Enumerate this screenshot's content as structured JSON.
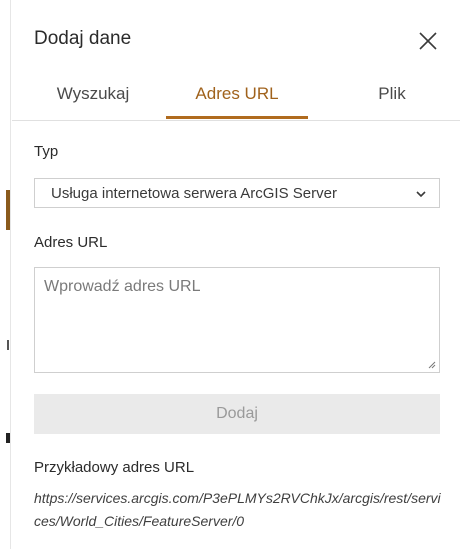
{
  "dialog": {
    "title": "Dodaj dane"
  },
  "tabs": [
    {
      "label": "Wyszukaj",
      "active": false
    },
    {
      "label": "Adres URL",
      "active": true
    },
    {
      "label": "Plik",
      "active": false
    }
  ],
  "form": {
    "type_label": "Typ",
    "type_value": "Usługa internetowa serwera ArcGIS Server",
    "url_label": "Adres URL",
    "url_placeholder": "Wprowadź adres URL",
    "url_value": "",
    "add_label": "Dodaj",
    "add_enabled": false
  },
  "example": {
    "title": "Przykładowy adres URL",
    "url": "https://services.arcgis.com/P3ePLMYs2RVChkJx/arcgis/rest/services/World_Cities/FeatureServer/0"
  },
  "colors": {
    "accent": "#b06b1e",
    "disabled_button_bg": "#eaeaea",
    "disabled_button_text": "#9a9a9a"
  },
  "icons": {
    "close": "close-icon",
    "dropdown": "chevron-down-icon",
    "resize": "resize-handle-icon"
  }
}
